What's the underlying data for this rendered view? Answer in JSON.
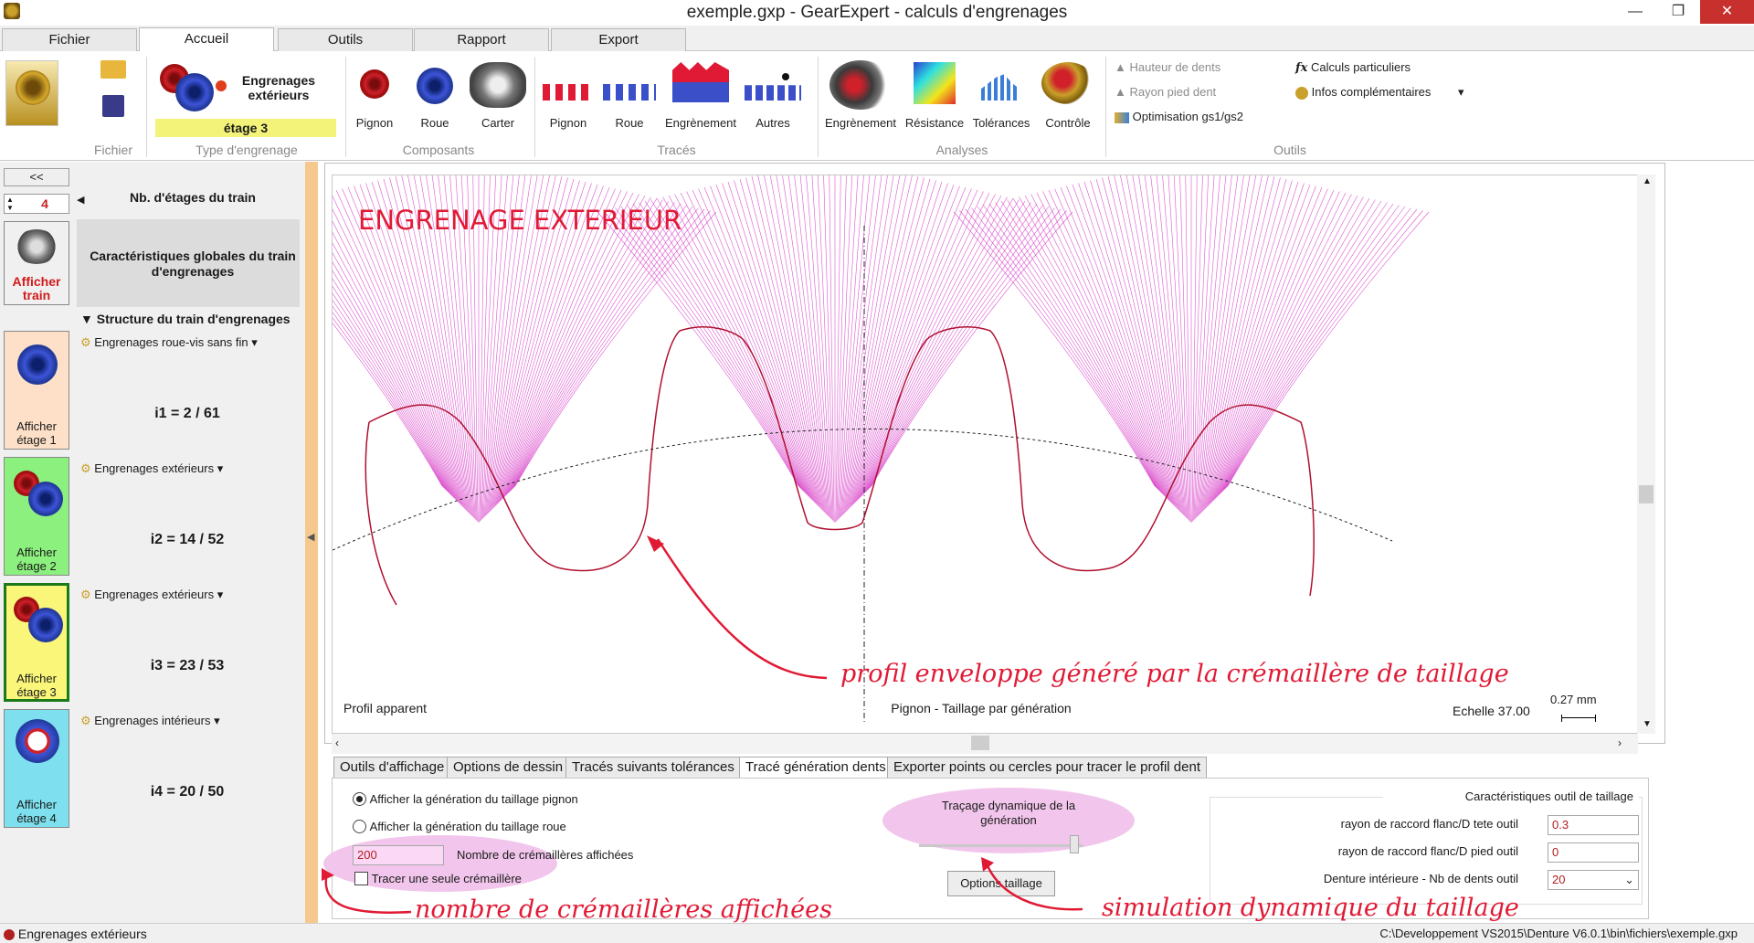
{
  "window": {
    "title": "exemple.gxp - GearExpert - calculs d'engrenages",
    "minimize": "—",
    "maximize": "❐",
    "close": "✕"
  },
  "tabs": [
    "Fichier",
    "Accueil",
    "Outils",
    "Rapport",
    "Export"
  ],
  "ribbon": {
    "engrenages_ext": "Engrenages extérieurs",
    "etage": "étage 3",
    "comp": [
      "Pignon",
      "Roue",
      "Carter"
    ],
    "traces": [
      "Pignon",
      "Roue",
      "Engrènement",
      "Autres"
    ],
    "analyses": [
      "Engrènement",
      "Résistance",
      "Tolérances",
      "Contrôle"
    ],
    "outils": [
      "Hauteur de dents",
      "Rayon pied dent",
      "Optimisation gs1/gs2"
    ],
    "outils2": [
      "Calculs particuliers",
      "Infos complémentaires"
    ],
    "groups": [
      "Fichier",
      "Type d'engrenage",
      "Composants",
      "Tracés",
      "Analyses",
      "Outils"
    ],
    "fx": "fx"
  },
  "left": {
    "collapse": "<<",
    "nb_etages_value": "4",
    "nb_etages_label": "Nb. d'étages du train",
    "afficher_train": "Afficher train",
    "carac_globales": "Caractéristiques globales du train d'engrenages",
    "structure": "Structure du train d'engrenages",
    "stages": [
      {
        "type": "Engrenages roue-vis sans fin",
        "ratio": "i1 = 2 / 61",
        "label": "Afficher étage 1",
        "bg": "#fde0c7"
      },
      {
        "type": "Engrenages extérieurs",
        "ratio": "i2 = 14 / 52",
        "label": "Afficher étage 2",
        "bg": "#8cf07e"
      },
      {
        "type": "Engrenages extérieurs",
        "ratio": "i3 = 23 / 53",
        "label": "Afficher étage 3",
        "bg": "#f9f67a"
      },
      {
        "type": "Engrenages intérieurs",
        "ratio": "i4 = 20 / 50",
        "label": "Afficher étage 4",
        "bg": "#7ee0ee"
      }
    ]
  },
  "drawing": {
    "heading": "ENGRENAGE EXTERIEUR",
    "profil": "Profil apparent",
    "caption": "Pignon - Taillage par génération",
    "echelle": "Echelle  37.00",
    "scale_len": "0.27  mm",
    "annot_profil": "profil enveloppe généré par la crémaillère de taillage"
  },
  "bottom_tabs": [
    "Outils d'affichage",
    "Options de dessin",
    "Tracés suivants tolérances",
    "Tracé génération dents",
    "Exporter points ou cercles pour tracer le profil dent"
  ],
  "panel": {
    "radio1": "Afficher la génération du taillage pignon",
    "radio2": "Afficher la génération du taillage roue",
    "nb_value": "200",
    "nb_label": "Nombre de crémaillères affichées",
    "single": "Tracer une seule crémaillère",
    "dyn_label": "Traçage dynamique de la génération",
    "options_btn": "Options taillage",
    "outil_title": "Caractéristiques outil de taillage",
    "outil_rows": [
      {
        "label": "rayon de raccord flanc/D tete outil",
        "value": "0.3"
      },
      {
        "label": "rayon de raccord flanc/D pied outil",
        "value": "0"
      },
      {
        "label": "Denture intérieure - Nb de dents outil",
        "value": "20"
      }
    ],
    "annot_nb": "nombre de crémaillères affichées",
    "annot_sim": "simulation dynamique du taillage"
  },
  "status": {
    "left": "Engrenages extérieurs",
    "right": "C:\\Developpement VS2015\\Denture V6.0.1\\bin\\fichiers\\exemple.gxp"
  },
  "colors": {
    "accent": "#e01a35",
    "curve": "#d21fbf",
    "stage_highlight": "#f3f37a"
  }
}
